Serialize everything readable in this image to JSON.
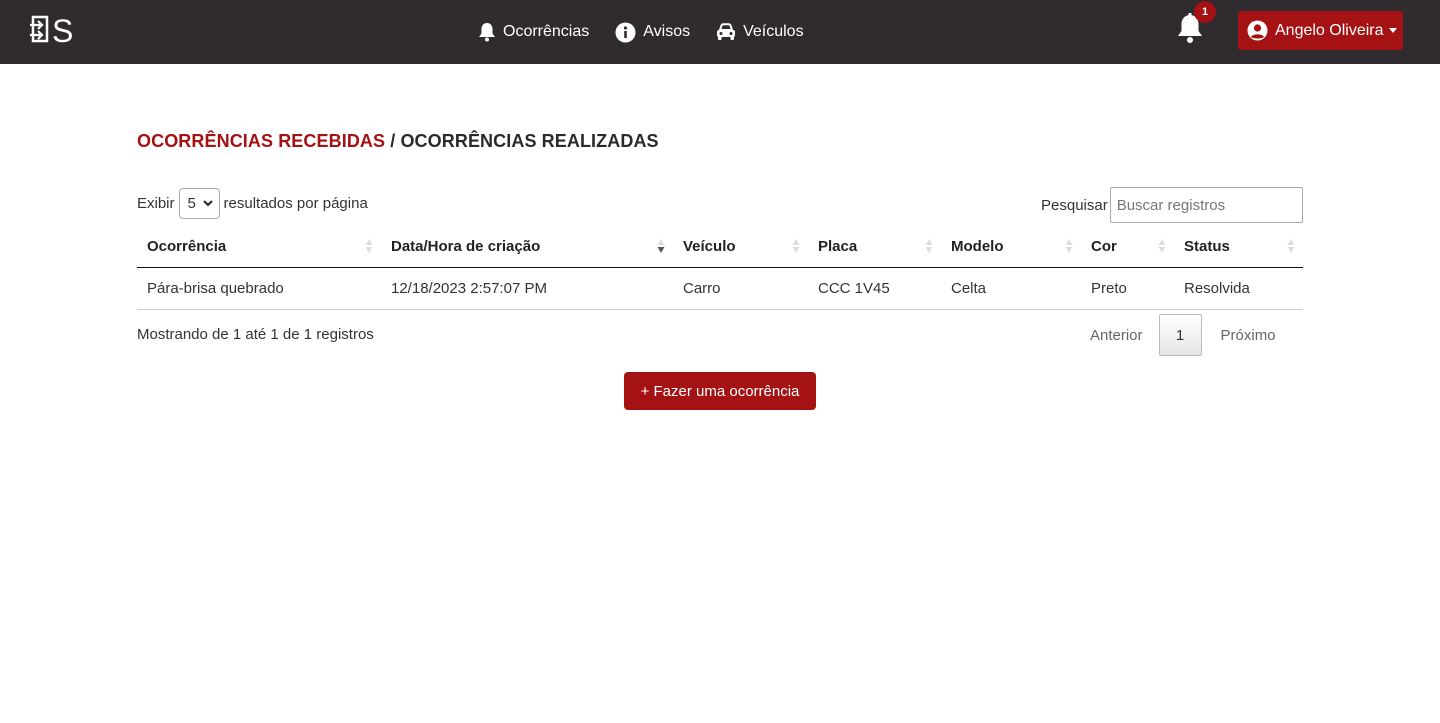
{
  "navbar": {
    "logo_text": "S",
    "links": [
      {
        "label": "Ocorrências",
        "icon": "bell-icon"
      },
      {
        "label": "Avisos",
        "icon": "info-icon"
      },
      {
        "label": "Veículos",
        "icon": "car-icon"
      }
    ],
    "notifications": {
      "count": "1",
      "icon": "bell-icon"
    },
    "user": {
      "name": "Angelo Oliveira",
      "icon": "user-circle-icon"
    }
  },
  "heading": {
    "received": "OCORRÊNCIAS RECEBIDAS",
    "separator": "/",
    "made": "OCORRÊNCIAS REALIZADAS"
  },
  "controls": {
    "show_label": "Exibir",
    "page_size": "5",
    "per_page_label": "resultados por página",
    "search_label": "Pesquisar",
    "search_placeholder": "Buscar registros"
  },
  "table": {
    "headers": [
      "Ocorrência",
      "Data/Hora de criação",
      "Veículo",
      "Placa",
      "Modelo",
      "Cor",
      "Status"
    ],
    "rows": [
      [
        "Pára-brisa quebrado",
        "12/18/2023 2:57:07 PM",
        "Carro",
        "CCC 1V45",
        "Celta",
        "Preto",
        "Resolvida"
      ]
    ]
  },
  "footer": {
    "info": "Mostrando de 1 até 1 de 1 registros",
    "prev": "Anterior",
    "current_page": "1",
    "next": "Próximo"
  },
  "cta": {
    "label": "+ Fazer uma ocorrência"
  },
  "colors": {
    "brand_red": "#a51213",
    "navbar": "#2f2b2f"
  }
}
